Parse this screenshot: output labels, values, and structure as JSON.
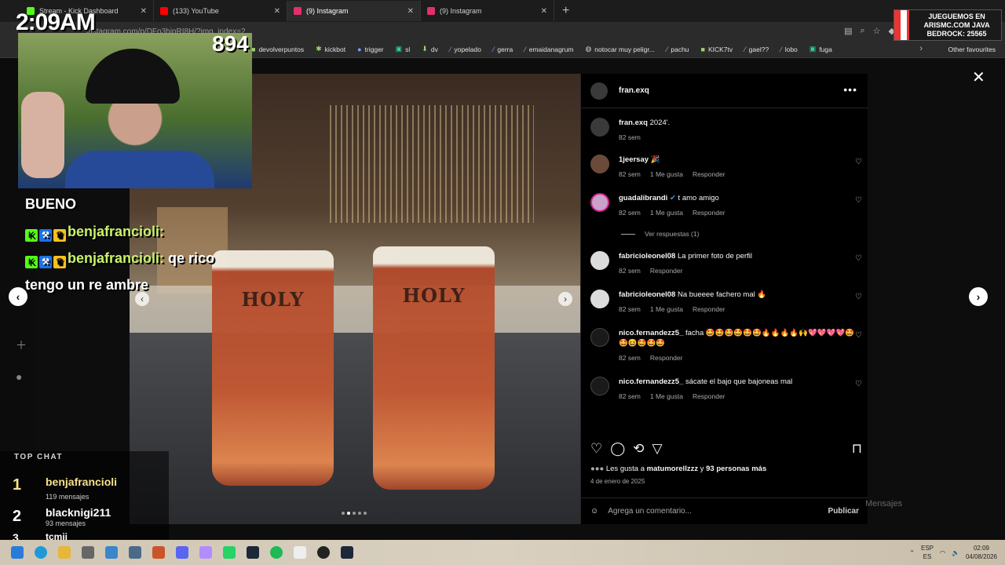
{
  "browser": {
    "tabs": [
      {
        "title": "Stream - Kick Dashboard",
        "color": "#53fc18",
        "active": false
      },
      {
        "title": "(133) YouTube",
        "color": "#ff0000",
        "active": false
      },
      {
        "title": "(9) Instagram",
        "color": "#e1306c",
        "active": true
      },
      {
        "title": "(9) Instagram",
        "color": "#e1306c",
        "active": false
      }
    ],
    "address": "instagram.com/p/DFo3hipRI8H/?img_index=2",
    "bookmarks": [
      "devolverpuntos",
      "kickbot",
      "trigger",
      "sl",
      "dv",
      "yopelado",
      "gerra",
      "emaidanagrum",
      "notocar muy peligr...",
      "pachu",
      "KICK7tv",
      "gael??",
      "lobo",
      "fuga"
    ],
    "other_favourites": "Other favourites"
  },
  "stream_overlay": {
    "time": "2:09AM",
    "viewers": "894",
    "chat": [
      {
        "user": "",
        "text": "BUENO"
      },
      {
        "user": "benjafrancioli:",
        "text": ""
      },
      {
        "user": "benjafrancioli:",
        "text": "qe rico"
      },
      {
        "user": "",
        "text": "tengo un re ambre"
      }
    ],
    "top_chat_title": "TOP CHAT",
    "top_chat": [
      {
        "rank": "1",
        "name": "benjafrancioli",
        "count": "119 mensajes"
      },
      {
        "rank": "2",
        "name": "blacknigi211",
        "count": "93 mensajes"
      },
      {
        "rank": "3",
        "name": "tcmii",
        "count": ""
      }
    ],
    "promo": "JUEGUEMOS EN ARISMC.COM JAVA BEDROCK: 25565"
  },
  "post": {
    "author": "fran.exq",
    "glass_text": "HOLY",
    "caption": {
      "user": "fran.exq",
      "text": "2024'.",
      "time": "82 sem"
    },
    "comments": [
      {
        "user": "1jeersay",
        "text": "🎉",
        "time": "82 sem",
        "likes": "1 Me gusta",
        "reply": "Responder"
      },
      {
        "user": "guadalibrandi",
        "text": "t amo amigo",
        "time": "82 sem",
        "likes": "1 Me gusta",
        "reply": "Responder"
      },
      {
        "user": "fabricioleonel08",
        "text": "La primer foto de perfil",
        "time": "82 sem",
        "likes": "",
        "reply": "Responder"
      },
      {
        "user": "fabricioleonel08",
        "text": "Na bueeee fachero mal 🔥",
        "time": "82 sem",
        "likes": "1 Me gusta",
        "reply": "Responder"
      },
      {
        "user": "nico.fernandezz5_",
        "text": "facha 🤩🤩🤩🤩🤩🤩🔥🔥🔥🔥🙌💖💖💖💖🤩🤩😆🤩🤩🤩",
        "time": "82 sem",
        "likes": "",
        "reply": "Responder"
      },
      {
        "user": "nico.fernandezz5_",
        "text": "sácate el bajo que bajoneas mal",
        "time": "82 sem",
        "likes": "1 Me gusta",
        "reply": "Responder"
      }
    ],
    "view_replies": "Ver respuestas (1)",
    "likes_prefix": "Les gusta a",
    "likes_user": "matumorellzzz",
    "likes_mid": "y",
    "likes_others": "93 personas más",
    "date": "4 de enero de 2025",
    "comment_placeholder": "Agrega un comentario...",
    "publish": "Publicar",
    "messages_label": "Mensajes"
  },
  "taskbar": {
    "lang": "ESP",
    "region": "ES",
    "time": "02:09",
    "date": "04/08/2026"
  }
}
